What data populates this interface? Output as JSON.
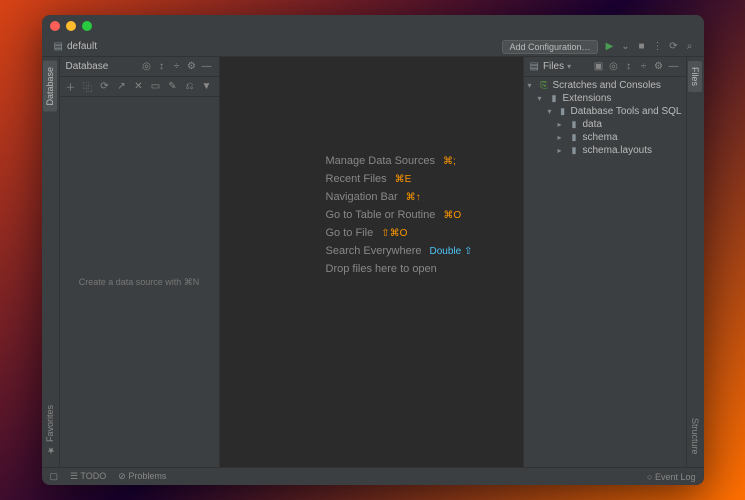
{
  "window": {
    "title": "default"
  },
  "toolbar": {
    "addConfig": "Add Configuration…"
  },
  "db": {
    "title": "Database",
    "hint": "Create a data source with ⌘N"
  },
  "welcome": {
    "items": [
      {
        "label": "Manage Data Sources",
        "shortcut": "⌘;"
      },
      {
        "label": "Recent Files",
        "shortcut": "⌘E"
      },
      {
        "label": "Navigation Bar",
        "shortcut": "⌘↑"
      },
      {
        "label": "Go to Table or Routine",
        "shortcut": "⌘O"
      },
      {
        "label": "Go to File",
        "shortcut": "⇧⌘O"
      },
      {
        "label": "Search Everywhere",
        "shortcut": "Double ⇧"
      },
      {
        "label": "Drop files here to open",
        "shortcut": ""
      }
    ]
  },
  "files": {
    "title": "Files",
    "tree": [
      {
        "depth": 0,
        "arrow": "▾",
        "iconCls": "scratch",
        "icon": "⎘",
        "label": "Scratches and Consoles"
      },
      {
        "depth": 1,
        "arrow": "▾",
        "iconCls": "folder",
        "icon": "▮",
        "label": "Extensions"
      },
      {
        "depth": 2,
        "arrow": "▾",
        "iconCls": "folder",
        "icon": "▮",
        "label": "Database Tools and SQL"
      },
      {
        "depth": 3,
        "arrow": "▸",
        "iconCls": "folder",
        "icon": "▮",
        "label": "data"
      },
      {
        "depth": 3,
        "arrow": "▸",
        "iconCls": "folder",
        "icon": "▮",
        "label": "schema"
      },
      {
        "depth": 3,
        "arrow": "▸",
        "iconCls": "folder",
        "icon": "▮",
        "label": "schema.layouts"
      }
    ]
  },
  "leftGutter": {
    "database": "Database",
    "favorites": "★ Favorites"
  },
  "rightGutter": {
    "files": "Files",
    "structure": "Structure"
  },
  "footer": {
    "todo": "TODO",
    "problems": "Problems",
    "eventlog": "Event Log"
  }
}
